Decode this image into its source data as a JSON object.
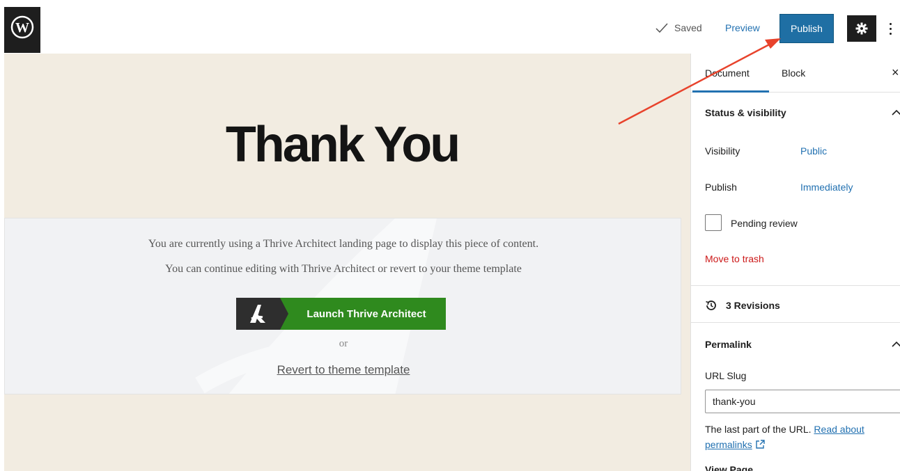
{
  "topbar": {
    "saved_label": "Saved",
    "preview_label": "Preview",
    "publish_label": "Publish"
  },
  "canvas": {
    "title": "Thank You",
    "notice_line1": "You are currently using a Thrive Architect landing page to display this piece of content.",
    "notice_line2": "You can continue editing with Thrive Architect or revert to your theme template",
    "launch_label": "Launch Thrive Architect",
    "or_label": "or",
    "revert_label": "Revert to theme template"
  },
  "sidebar": {
    "tabs": [
      {
        "label": "Document",
        "active": true
      },
      {
        "label": "Block",
        "active": false
      }
    ],
    "close_label": "×",
    "status": {
      "heading": "Status & visibility",
      "visibility_label": "Visibility",
      "visibility_value": "Public",
      "publish_label": "Publish",
      "publish_value": "Immediately",
      "pending_label": "Pending review",
      "trash_label": "Move to trash"
    },
    "revisions_label": "3 Revisions",
    "permalink": {
      "heading": "Permalink",
      "slug_label": "URL Slug",
      "slug_value": "thank-you",
      "help_prefix": "The last part of the URL.",
      "help_link": "Read about permalinks",
      "view_page_label": "View Page"
    }
  },
  "colors": {
    "accent": "#2271b1",
    "publish_bg": "#1f6fa4",
    "canvas_bg": "#f2ece1",
    "launch_green": "#2f8a1e",
    "trash_red": "#cc1818",
    "arrow_red": "#e8432c"
  },
  "icons": [
    "wordpress-logo-icon",
    "check-icon",
    "gear-icon",
    "more-vertical-icon",
    "close-icon",
    "chevron-up-icon",
    "history-icon",
    "external-link-icon",
    "thrive-architect-logo-icon"
  ]
}
